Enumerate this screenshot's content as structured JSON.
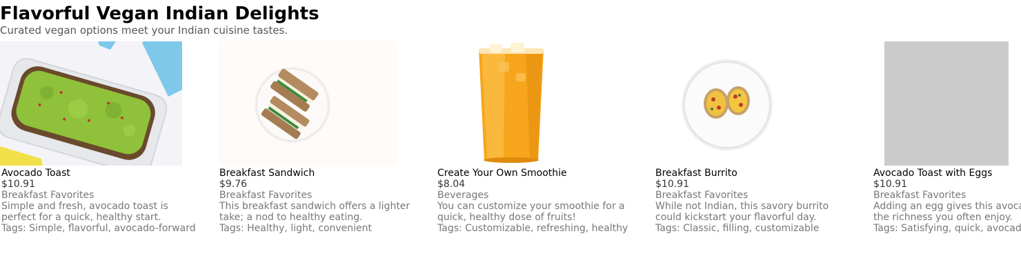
{
  "page": {
    "title": "Flavorful Vegan Indian Delights",
    "subtitle": "Curated vegan options meet your Indian cuisine tastes."
  },
  "items": [
    {
      "name": "Avocado Toast",
      "price": "$10.91",
      "category": "Breakfast Favorites",
      "description": "Simple and fresh, avocado toast is perfect for a quick, healthy start.",
      "tags": "Tags: Simple, flavorful, avocado-forward"
    },
    {
      "name": "Breakfast Sandwich",
      "price": "$9.76",
      "category": "Breakfast Favorites",
      "description": "This breakfast sandwich offers a lighter take; a nod to healthy eating.",
      "tags": "Tags: Healthy, light, convenient"
    },
    {
      "name": "Create Your Own Smoothie",
      "price": "$8.04",
      "category": "Beverages",
      "description": "You can customize your smoothie for a quick, healthy dose of fruits!",
      "tags": "Tags: Customizable, refreshing, healthy"
    },
    {
      "name": "Breakfast Burrito",
      "price": "$10.91",
      "category": "Breakfast Favorites",
      "description": "While not Indian, this savory burrito could kickstart your flavorful day.",
      "tags": "Tags: Classic, filling, customizable"
    },
    {
      "name": "Avocado Toast with Eggs",
      "price": "$10.91",
      "category": "Breakfast Favorites",
      "description": "Adding an egg gives this avocado toast the richness you often enjoy.",
      "tags": "Tags: Satisfying, quick, avocado-forward"
    }
  ]
}
